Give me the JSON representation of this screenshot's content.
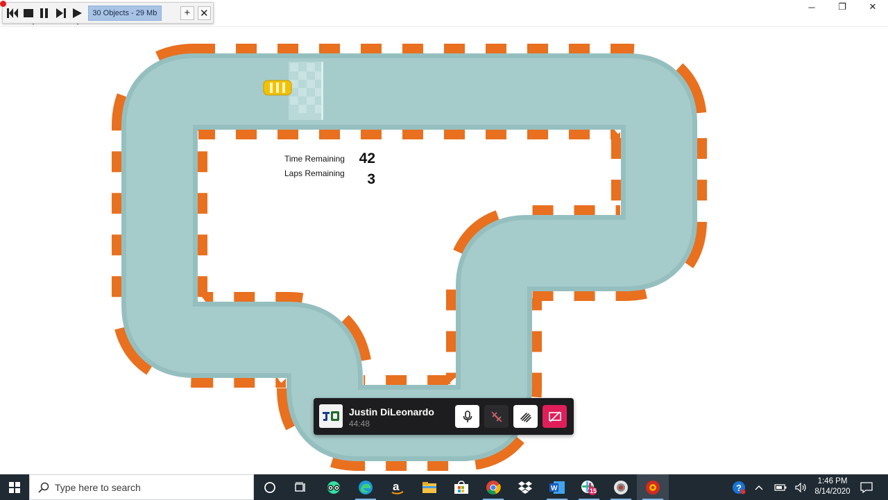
{
  "window": {
    "minimize": "─",
    "restore": "❐",
    "close": "✕"
  },
  "menu": {
    "items": [
      "File",
      "Options",
      "Help"
    ]
  },
  "recorder": {
    "status": "30 Objects - 29 Mb",
    "add": "+",
    "close": "✕"
  },
  "hud": {
    "time_label": "Time Remaining",
    "time_value": "42",
    "laps_label": "Laps Remaining",
    "laps_value": "3"
  },
  "call": {
    "initials": "JD",
    "name": "Justin DiLeonardo",
    "duration": "44:48",
    "colors": {
      "panel": "#1d1d1f",
      "end": "#e01e5a",
      "button": "#ffffff"
    }
  },
  "track": {
    "colors": {
      "asphalt": "#a6cbcb",
      "asphalt_edge": "#95bfbf",
      "curb_orange": "#e8701f",
      "curb_white": "#ffffff",
      "car": "#f2c200"
    }
  },
  "taskbar": {
    "search_placeholder": "Type here to search",
    "time": "1:46 PM",
    "date": "8/14/2020",
    "slack_badge": "15",
    "apps": [
      "cortana-icon",
      "task-view-icon",
      "tripadvisor-icon",
      "edge-icon",
      "amazon-icon",
      "file-explorer-icon",
      "store-icon",
      "chrome-icon",
      "dropbox-icon",
      "word-icon",
      "slack-icon",
      "app-icon",
      "game-icon"
    ]
  }
}
